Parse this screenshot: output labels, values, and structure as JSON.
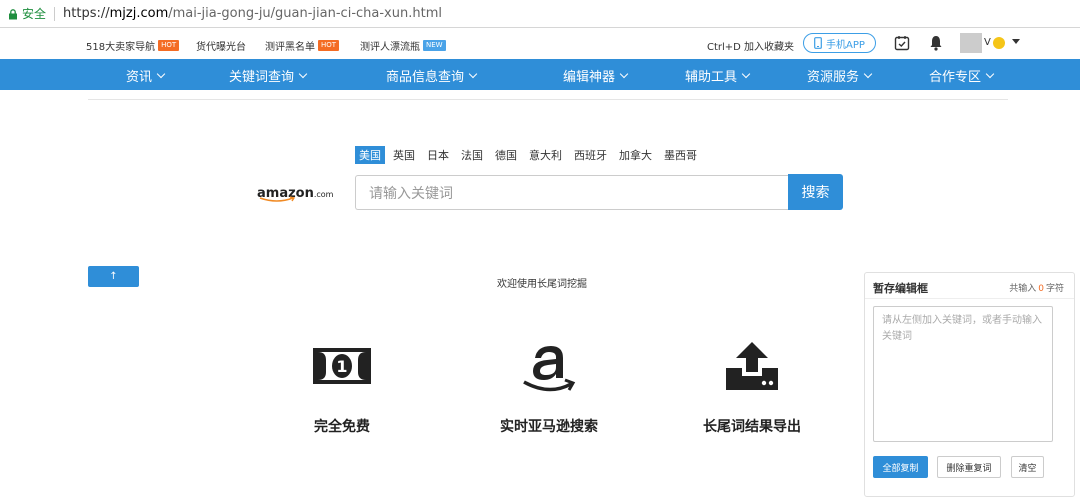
{
  "browser": {
    "secure_label": "安全",
    "url_scheme": "https://",
    "url_host": "mjzj.com",
    "url_path": "/mai-jia-gong-ju/guan-jian-ci-cha-xun.html"
  },
  "toplinks": [
    {
      "label": "518大卖家导航",
      "badge": "HOT"
    },
    {
      "label": "货代曝光台",
      "badge": ""
    },
    {
      "label": "测评黑名单",
      "badge": "HOT"
    },
    {
      "label": "测评人漂流瓶",
      "badge": "NEW"
    }
  ],
  "topright": {
    "favorite": "Ctrl+D 加入收藏夹",
    "app_button": "手机APP",
    "user_initial": "V"
  },
  "nav": [
    {
      "label": "资讯"
    },
    {
      "label": "关键词查询"
    },
    {
      "label": "商品信息查询"
    },
    {
      "label": "编辑神器"
    },
    {
      "label": "辅助工具"
    },
    {
      "label": "资源服务"
    },
    {
      "label": "合作专区"
    }
  ],
  "countries": [
    "美国",
    "英国",
    "日本",
    "法国",
    "德国",
    "意大利",
    "西班牙",
    "加拿大",
    "墨西哥"
  ],
  "active_country": "美国",
  "search": {
    "logo_word": "amazon",
    "logo_suffix": ".com",
    "placeholder": "请输入关键词",
    "button": "搜索"
  },
  "up_button": "↑",
  "welcome": "欢迎使用长尾词挖掘",
  "features": [
    {
      "label": "完全免费",
      "icon": "money-icon"
    },
    {
      "label": "实时亚马逊搜索",
      "icon": "amazon-icon"
    },
    {
      "label": "长尾词结果导出",
      "icon": "upload-icon"
    }
  ],
  "panel": {
    "title": "暂存编辑框",
    "count_prefix": "共输入",
    "count_value": "0",
    "count_suffix": "字符",
    "placeholder": "请从左侧加入关键词，或者手动输入关键词",
    "copy_all": "全部复制",
    "remove_dupes": "删除重复词",
    "clear": "清空"
  },
  "colors": {
    "brand_blue": "#2f8ed8",
    "hot": "#f46c24",
    "new": "#4aa3e8"
  }
}
